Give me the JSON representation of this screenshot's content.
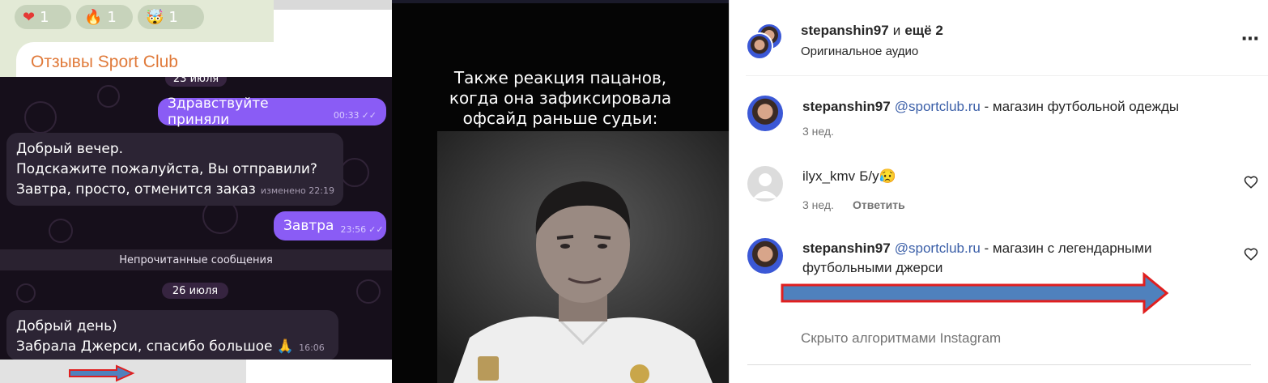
{
  "telegram": {
    "reactions": [
      {
        "icon": "heart-emoji",
        "glyph": "❤",
        "count": "1"
      },
      {
        "icon": "fire-emoji",
        "glyph": "🔥",
        "count": "1"
      },
      {
        "icon": "mind-blown-emoji",
        "glyph": "🤯",
        "count": "1"
      }
    ],
    "channel_name": "Отзывы Sport Club",
    "date_1": "23 июля",
    "msg_out_1": {
      "text": "Здравствуйте приняли",
      "time": "00:33"
    },
    "msg_in_1": {
      "line1": "Добрый вечер.",
      "line2": "Подскажите пожалуйста, Вы отправили?",
      "line3": "Завтра, просто, отменится заказ",
      "time": "изменено 22:19"
    },
    "msg_out_2": {
      "text": "Завтра",
      "time": "23:56"
    },
    "unread_label": "Непрочитанные сообщения",
    "date_2": "26 июля",
    "msg_in_2": {
      "line1": "Добрый день)",
      "line2": "Забрала Джерси, спасибо большое 🙏",
      "time": "16:06"
    },
    "colors": {
      "outgoing": "#8a5cf5",
      "incoming": "#2c2434",
      "channel": "#e07a3a"
    }
  },
  "video": {
    "caption_line1": "Также реакция пацанов,",
    "caption_line2": "когда она зафиксировала",
    "caption_line3": "офсайд раньше судьи:"
  },
  "instagram": {
    "header": {
      "user": "stepanshin97",
      "and_more": "и",
      "more_count": "ещё 2",
      "audio": "Оригинальное аудио",
      "more_icon": "⋯"
    },
    "comments": [
      {
        "user": "stepanshin97",
        "mention": "@sportclub.ru",
        "text": " - магазин футбольной одежды",
        "time": "3 нед."
      },
      {
        "user": "ilyx_kmv",
        "text": "Б/у😥",
        "time": "3 нед.",
        "reply": "Ответить"
      },
      {
        "user": "stepanshin97",
        "mention": "@sportclub.ru",
        "text": " - магазин с легендарными",
        "text2": "футбольными джерси"
      }
    ],
    "hidden_label": "Скрыто алгоритмами Instagram",
    "colors": {
      "mention": "#3b5fa8",
      "arrow_fill": "#4f81bd",
      "arrow_stroke": "#e01f1f"
    }
  }
}
